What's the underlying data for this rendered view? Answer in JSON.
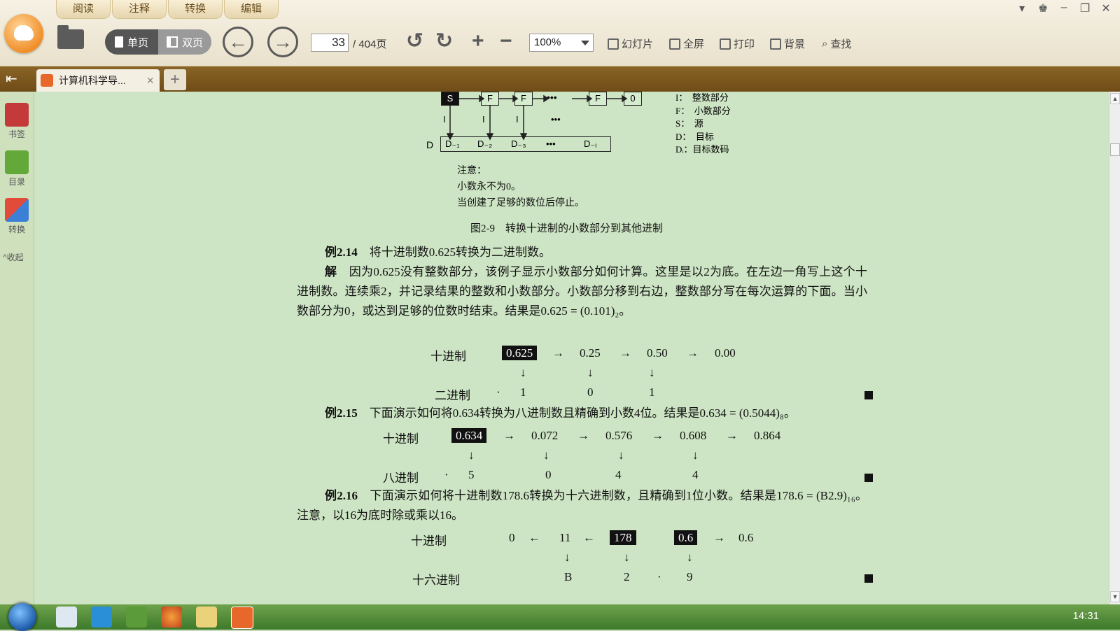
{
  "app": {
    "menu_tabs": [
      "阅读",
      "注释",
      "转换",
      "编辑"
    ],
    "window_controls": [
      "menu-icon",
      "skin-icon",
      "minimize-icon",
      "restore-icon",
      "close-icon"
    ]
  },
  "toolbar": {
    "view_single": "单页",
    "view_double": "双页",
    "current_page": "33",
    "page_total": "/ 404页",
    "zoom_value": "100%",
    "slideshow": "幻灯片",
    "fullscreen": "全屏",
    "print": "打印",
    "background": "背景",
    "find": "查找"
  },
  "tabs": {
    "doc_tab_title": "计算机科学导...",
    "add": "+"
  },
  "sidebar": {
    "items": [
      {
        "label": "书签",
        "icon": "bookmark-icon"
      },
      {
        "label": "目录",
        "icon": "toc-icon"
      },
      {
        "label": "转换",
        "icon": "convert-icon"
      }
    ],
    "collapse": "^收起"
  },
  "document": {
    "diagram": {
      "top_boxes": [
        "S",
        "F",
        "F",
        "•••",
        "F",
        "0"
      ],
      "bottom_row_label": "D",
      "bottom_boxes": [
        "D₋₁",
        "D₋₂",
        "D₋₃",
        "•••",
        "D₋ᵢ"
      ],
      "arrow_labels": [
        "I",
        "I",
        "I",
        "•••"
      ],
      "legend": [
        "I：　整数部分",
        "F：　小数部分",
        "S：　源",
        "D：　目标",
        "Dᵢ：目标数码"
      ]
    },
    "note_title": "注意：",
    "note_lines": [
      "小数永不为0。",
      "当创建了足够的数位后停止。"
    ],
    "figure_caption": "图2-9　转换十进制的小数部分到其他进制",
    "ex14_title": "例2.14",
    "ex14_text": "将十进制数0.625转换为二进制数。",
    "sol_label": "解",
    "sol_text": "因为0.625没有整数部分，该例子显示小数部分如何计算。这里是以2为底。在左边一角写上这个十进制数。连续乘2，并记录结果的整数和小数部分。小数部分移到右边，整数部分写在每次运算的下面。当小数部分为0，或达到足够的位数时结束。结果是0.625 = (0.101)₂。",
    "ex14_calc": {
      "row1_label": "十进制",
      "row1_values": [
        "0.625",
        "→",
        "0.25",
        "→",
        "0.50",
        "→",
        "0.00"
      ],
      "arrows": [
        "↓",
        "↓",
        "↓"
      ],
      "row2_label": "二进制",
      "row2_dot": "·",
      "row2_values": [
        "1",
        "0",
        "1"
      ]
    },
    "ex15_title": "例2.15",
    "ex15_text": "下面演示如何将0.634转换为八进制数且精确到小数4位。结果是0.634 = (0.5044)₈。",
    "ex15_calc": {
      "row1_label": "十进制",
      "row1_values": [
        "0.634",
        "→",
        "0.072",
        "→",
        "0.576",
        "→",
        "0.608",
        "→",
        "0.864"
      ],
      "arrows": [
        "↓",
        "↓",
        "↓",
        "↓"
      ],
      "row2_label": "八进制",
      "row2_dot": "·",
      "row2_values": [
        "5",
        "0",
        "4",
        "4"
      ]
    },
    "ex16_title": "例2.16",
    "ex16_text": "下面演示如何将十进制数178.6转换为十六进制数，且精确到1位小数。结果是178.6 = (B2.9)₁₆。注意，以16为底时除或乘以16。",
    "ex16_calc": {
      "row1_label": "十进制",
      "row1_values": [
        "0",
        "←",
        "11",
        "←",
        "178",
        "0.6",
        "→",
        "0.6"
      ],
      "arrows": [
        "↓",
        "↓",
        "↓"
      ],
      "row2_label": "十六进制",
      "row2_values": [
        "B",
        "2",
        "·",
        "9"
      ]
    }
  },
  "taskbar": {
    "time": "14:31"
  }
}
